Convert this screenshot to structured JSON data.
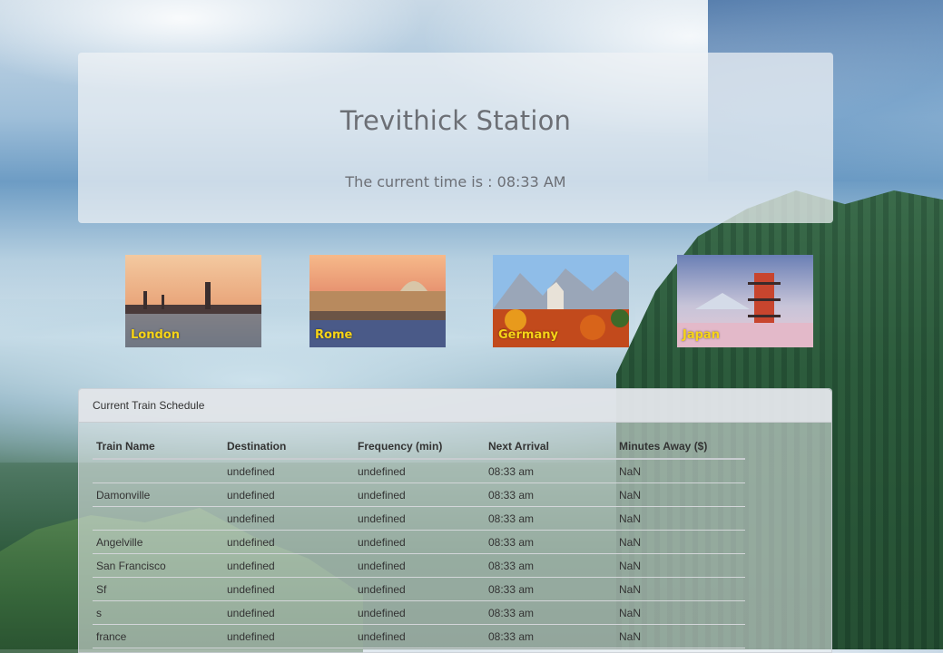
{
  "header": {
    "title": "Trevithick Station",
    "time_prefix": "The current time is : ",
    "time": "08:33 AM"
  },
  "destinations": [
    {
      "label": "London"
    },
    {
      "label": "Rome"
    },
    {
      "label": "Germany"
    },
    {
      "label": "Japan"
    }
  ],
  "schedule": {
    "heading": "Current Train Schedule",
    "columns": [
      "Train Name",
      "Destination",
      "Frequency (min)",
      "Next Arrival",
      "Minutes Away ($)"
    ],
    "rows": [
      [
        "",
        "undefined",
        "undefined",
        "08:33 am",
        "NaN"
      ],
      [
        "Damonville",
        "undefined",
        "undefined",
        "08:33 am",
        "NaN"
      ],
      [
        "",
        "undefined",
        "undefined",
        "08:33 am",
        "NaN"
      ],
      [
        "Angelville",
        "undefined",
        "undefined",
        "08:33 am",
        "NaN"
      ],
      [
        "San Francisco",
        "undefined",
        "undefined",
        "08:33 am",
        "NaN"
      ],
      [
        "Sf",
        "undefined",
        "undefined",
        "08:33 am",
        "NaN"
      ],
      [
        "s",
        "undefined",
        "undefined",
        "08:33 am",
        "NaN"
      ],
      [
        "france",
        "undefined",
        "undefined",
        "08:33 am",
        "NaN"
      ]
    ]
  },
  "colors": {
    "label_yellow": "#f7d417",
    "text_gray": "#6c6f75"
  }
}
